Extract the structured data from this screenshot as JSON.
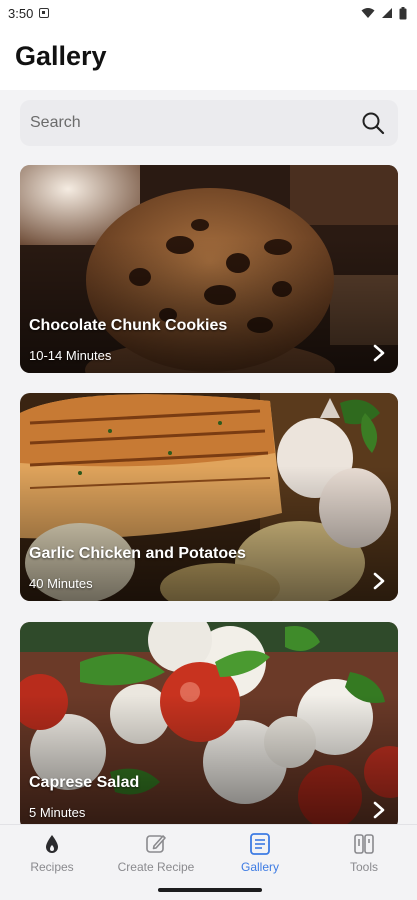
{
  "status_bar": {
    "time": "3:50"
  },
  "header": {
    "title": "Gallery"
  },
  "search": {
    "placeholder": "Search"
  },
  "recipes": [
    {
      "title": "Chocolate Chunk Cookies",
      "time": "10-14 Minutes"
    },
    {
      "title": "Garlic Chicken and Potatoes",
      "time": "40 Minutes"
    },
    {
      "title": "Caprese Salad",
      "time": "5 Minutes"
    }
  ],
  "nav": {
    "items": [
      {
        "label": "Recipes",
        "icon": "drop-icon"
      },
      {
        "label": "Create Recipe",
        "icon": "edit-icon"
      },
      {
        "label": "Gallery",
        "icon": "gallery-icon",
        "active": true
      },
      {
        "label": "Tools",
        "icon": "tools-icon"
      }
    ],
    "active_color": "#3d7be3",
    "inactive_color": "#8a8a8e"
  }
}
